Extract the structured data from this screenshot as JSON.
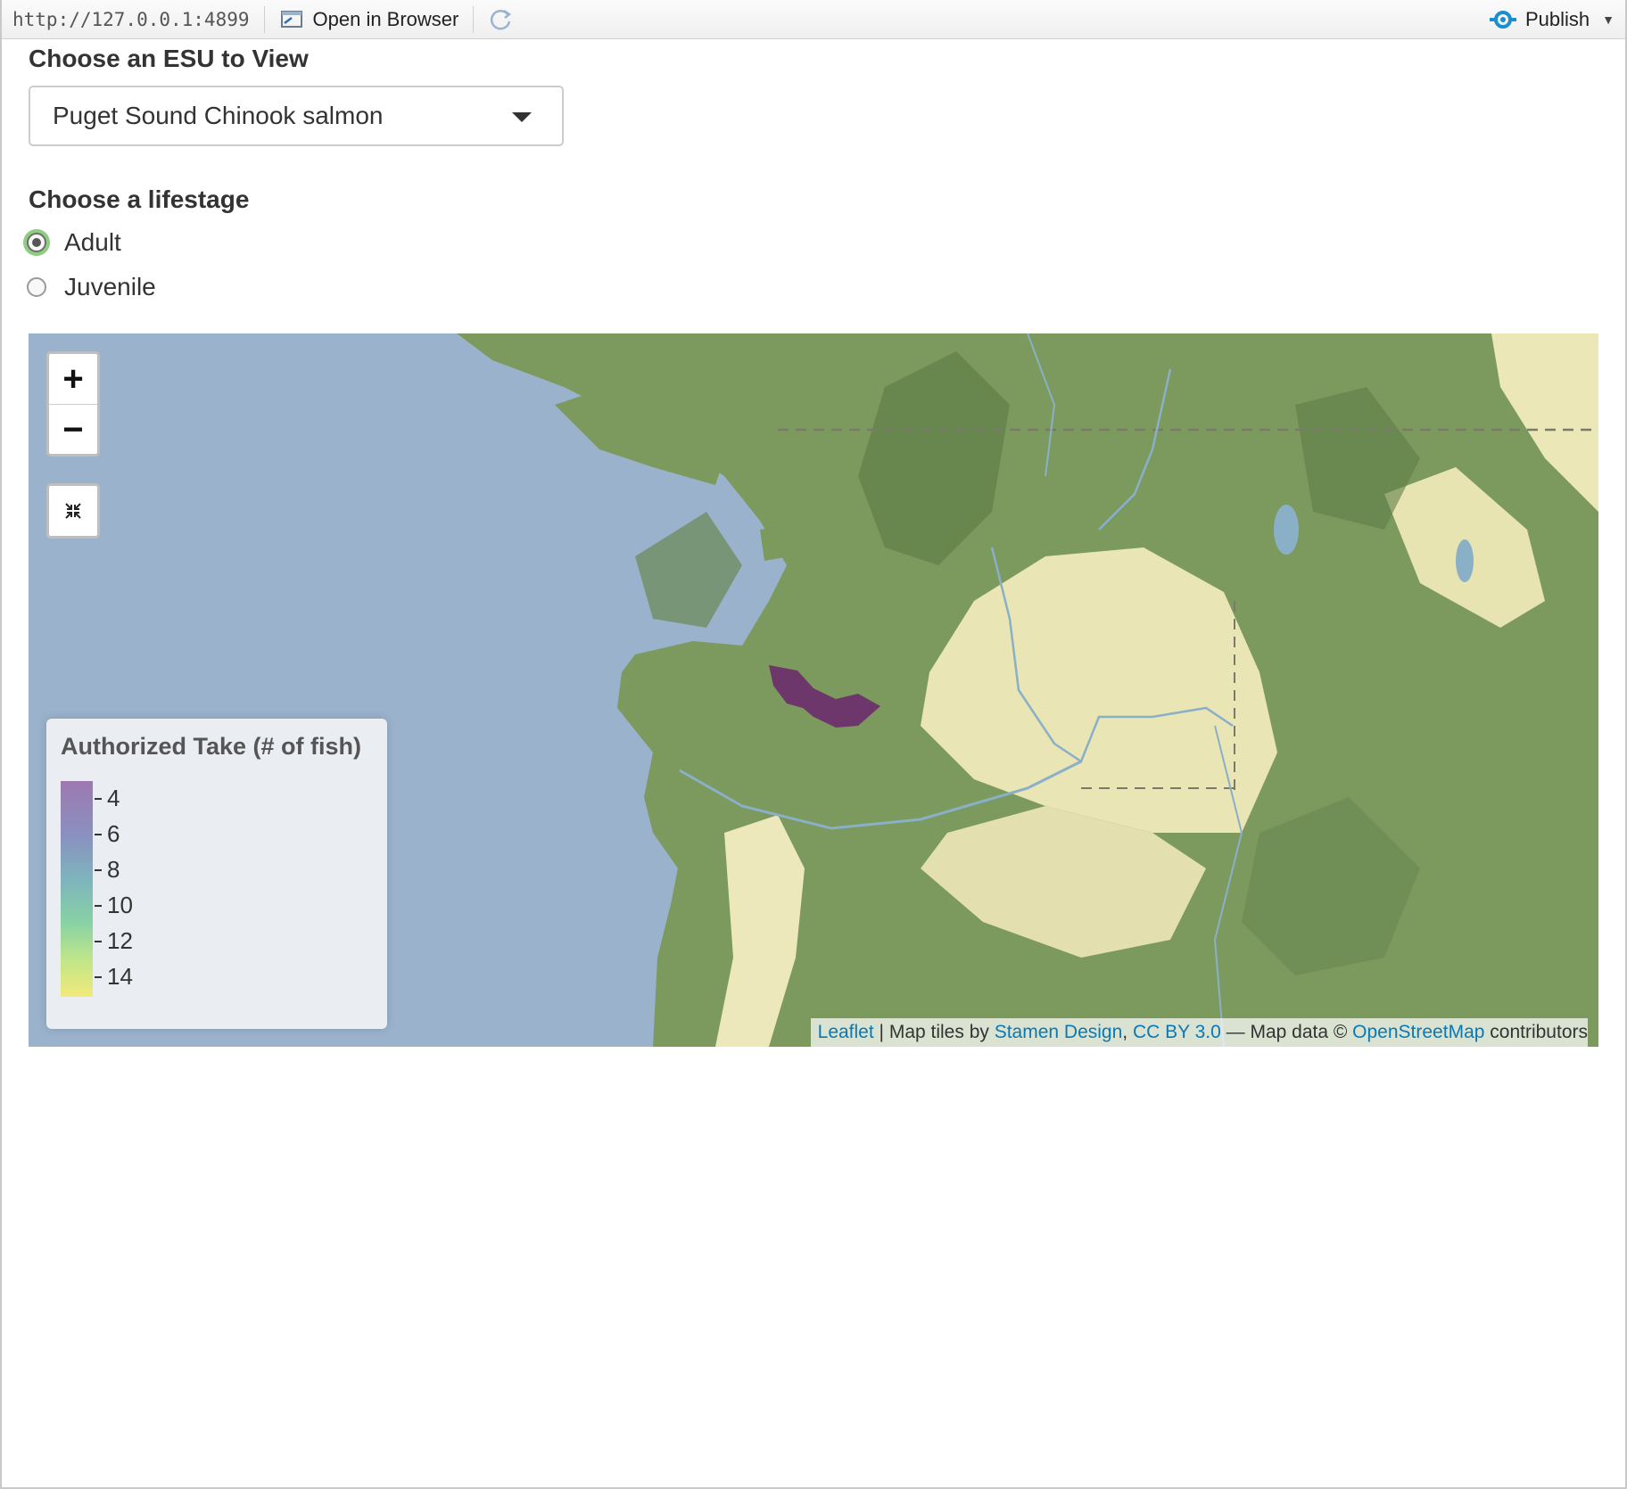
{
  "toolbar": {
    "url": "http://127.0.0.1:4899",
    "open_in_browser": "Open in Browser",
    "publish": "Publish"
  },
  "esu": {
    "label": "Choose an ESU to View",
    "selected": "Puget Sound Chinook salmon"
  },
  "lifestage": {
    "label": "Choose a lifestage",
    "options": [
      {
        "label": "Adult",
        "checked": true
      },
      {
        "label": "Juvenile",
        "checked": false
      }
    ]
  },
  "map": {
    "zoom_in": "+",
    "zoom_out": "−",
    "legend": {
      "title": "Authorized Take (# of fish)",
      "ticks": [
        "4",
        "6",
        "8",
        "10",
        "12",
        "14"
      ],
      "colors": [
        "#9d79b0",
        "#8a90bf",
        "#7fb3bd",
        "#86d1a6",
        "#bde58a",
        "#f2ea7a"
      ]
    },
    "highlight_color": "#6b2f6e",
    "attribution": {
      "leaflet": "Leaflet",
      "sep1": " | Map tiles by ",
      "stamen": "Stamen Design",
      "comma": ", ",
      "cc": "CC BY 3.0",
      "mid": " — Map data © ",
      "osm": "OpenStreetMap",
      "end": " contributors"
    }
  }
}
